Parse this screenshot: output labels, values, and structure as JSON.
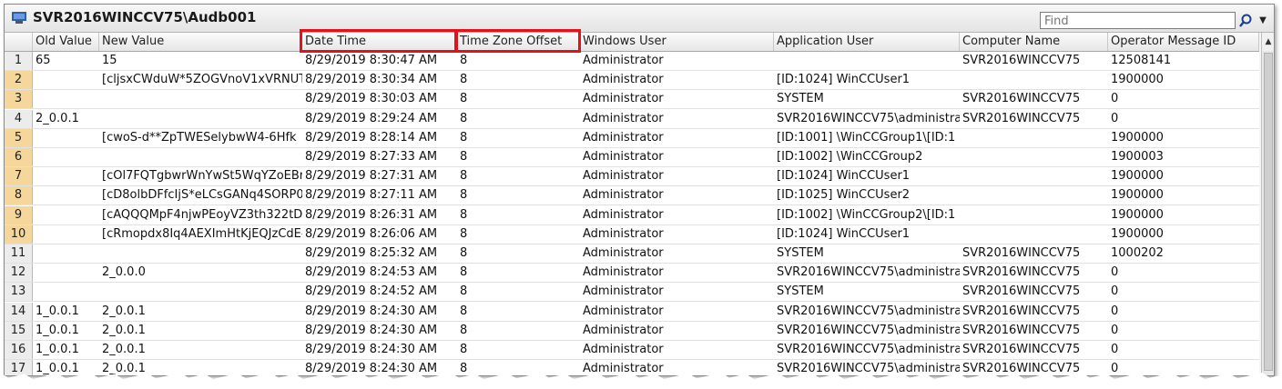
{
  "window": {
    "title": "SVR2016WINCCV75\\Audb001"
  },
  "find": {
    "placeholder": "Find",
    "value": "Find"
  },
  "columns": [
    "Old Value",
    "New Value",
    "Date Time",
    "Time Zone Offset",
    "Windows User",
    "Application User",
    "Computer Name",
    "Operator Message ID"
  ],
  "highlighted_columns": [
    "Date Time",
    "Time Zone Offset"
  ],
  "colors": {
    "highlight": "#e0121b",
    "selected_row_number": "#f6d79b"
  },
  "rows": [
    {
      "num": "1",
      "selected": false,
      "cells": [
        "65",
        "15",
        "8/29/2019 8:30:47 AM",
        "8",
        "Administrator",
        "",
        "SVR2016WINCCV75",
        "12508141"
      ]
    },
    {
      "num": "2",
      "selected": true,
      "cells": [
        "",
        "[cljsxCWduW*5ZOGVnoV1xVRNUT",
        "8/29/2019 8:30:34 AM",
        "8",
        "Administrator",
        "[ID:1024] WinCCUser1",
        "",
        "1900000"
      ]
    },
    {
      "num": "3",
      "selected": true,
      "cells": [
        "",
        "",
        "8/29/2019 8:30:03 AM",
        "8",
        "Administrator",
        "SYSTEM",
        "SVR2016WINCCV75",
        "0"
      ]
    },
    {
      "num": "4",
      "selected": false,
      "cells": [
        "2_0.0.1",
        "",
        "8/29/2019 8:29:24 AM",
        "8",
        "Administrator",
        "SVR2016WINCCV75\\administra",
        "SVR2016WINCCV75",
        "0"
      ]
    },
    {
      "num": "5",
      "selected": true,
      "cells": [
        "",
        "[cwoS-d**ZpTWESelybwW4-6Hfk",
        "8/29/2019 8:28:14 AM",
        "8",
        "Administrator",
        "[ID:1001] \\WinCCGroup1\\[ID:1",
        "",
        "1900000"
      ]
    },
    {
      "num": "6",
      "selected": true,
      "cells": [
        "",
        "",
        "8/29/2019 8:27:33 AM",
        "8",
        "Administrator",
        "[ID:1002] \\WinCCGroup2",
        "",
        "1900003"
      ]
    },
    {
      "num": "7",
      "selected": true,
      "cells": [
        "",
        "[cOl7FQTgbwrWnYwSt5WqYZoEBr",
        "8/29/2019 8:27:31 AM",
        "8",
        "Administrator",
        "[ID:1024] WinCCUser1",
        "",
        "1900000"
      ]
    },
    {
      "num": "8",
      "selected": true,
      "cells": [
        "",
        "[cD8olbDFfcIjS*eLCsGANq4SORP0",
        "8/29/2019 8:27:11 AM",
        "8",
        "Administrator",
        "[ID:1025] WinCCUser2",
        "",
        "1900000"
      ]
    },
    {
      "num": "9",
      "selected": true,
      "cells": [
        "",
        "[cAQQQMpF4njwPEoyVZ3th322tDV",
        "8/29/2019 8:26:31 AM",
        "8",
        "Administrator",
        "[ID:1002] \\WinCCGroup2\\[ID:1",
        "",
        "1900000"
      ]
    },
    {
      "num": "10",
      "selected": true,
      "cells": [
        "",
        "[cRmopdx8Iq4AEXImHtKjEQJzCdE-",
        "8/29/2019 8:26:06 AM",
        "8",
        "Administrator",
        "[ID:1024] WinCCUser1",
        "",
        "1900000"
      ]
    },
    {
      "num": "11",
      "selected": false,
      "cells": [
        "",
        "",
        "8/29/2019 8:25:32 AM",
        "8",
        "Administrator",
        "SYSTEM",
        "SVR2016WINCCV75",
        "1000202"
      ]
    },
    {
      "num": "12",
      "selected": false,
      "cells": [
        "",
        "2_0.0.0",
        "8/29/2019 8:24:53 AM",
        "8",
        "Administrator",
        "SVR2016WINCCV75\\administra",
        "SVR2016WINCCV75",
        "0"
      ]
    },
    {
      "num": "13",
      "selected": false,
      "cells": [
        "",
        "",
        "8/29/2019 8:24:52 AM",
        "8",
        "Administrator",
        "SYSTEM",
        "SVR2016WINCCV75",
        "0"
      ]
    },
    {
      "num": "14",
      "selected": false,
      "cells": [
        "1_0.0.1",
        "2_0.0.1",
        "8/29/2019 8:24:30 AM",
        "8",
        "Administrator",
        "SVR2016WINCCV75\\administra",
        "SVR2016WINCCV75",
        "0"
      ]
    },
    {
      "num": "15",
      "selected": false,
      "cells": [
        "1_0.0.1",
        "2_0.0.1",
        "8/29/2019 8:24:30 AM",
        "8",
        "Administrator",
        "SVR2016WINCCV75\\administra",
        "SVR2016WINCCV75",
        "0"
      ]
    },
    {
      "num": "16",
      "selected": false,
      "cells": [
        "1_0.0.1",
        "2_0.0.1",
        "8/29/2019 8:24:30 AM",
        "8",
        "Administrator",
        "SVR2016WINCCV75\\administra",
        "SVR2016WINCCV75",
        "0"
      ]
    },
    {
      "num": "17",
      "selected": false,
      "cells": [
        "1_0.0.1",
        "2_0.0.1",
        "8/29/2019 8:24:30 AM",
        "8",
        "Administrator",
        "SVR2016WINCCV75\\administra",
        "SVR2016WINCCV75",
        "0"
      ]
    }
  ]
}
